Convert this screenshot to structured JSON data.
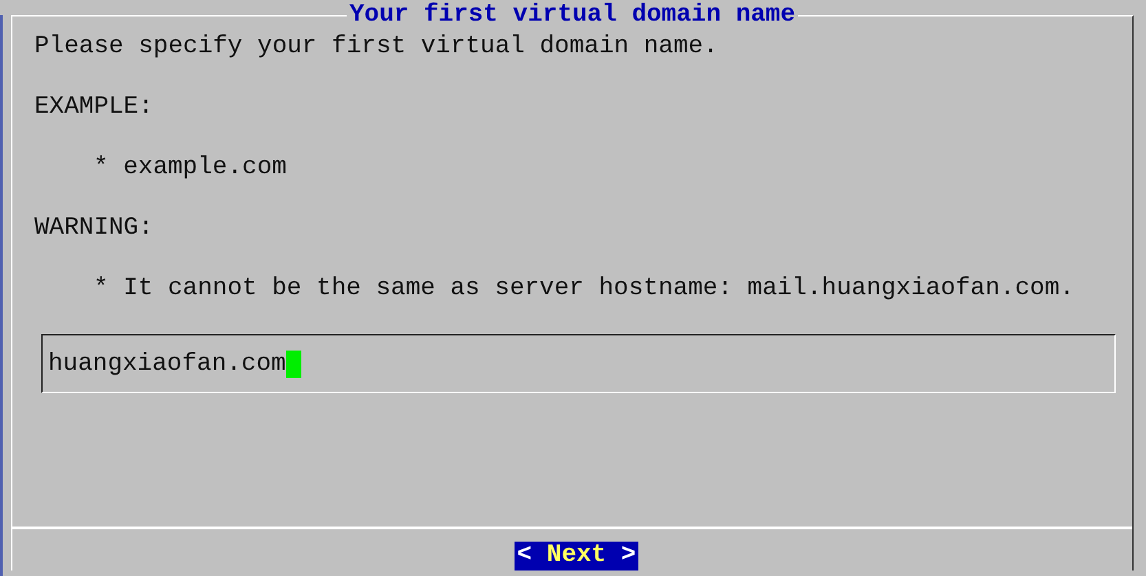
{
  "dialog": {
    "title": "Your first virtual domain name",
    "lines": [
      {
        "kind": "text",
        "text": "Please specify your first virtual domain name."
      },
      {
        "kind": "text",
        "text": "EXAMPLE:"
      },
      {
        "kind": "bullet",
        "text": "* example.com"
      },
      {
        "kind": "text",
        "text": "WARNING:"
      },
      {
        "kind": "bullet",
        "text": "* It cannot be the same as server hostname: mail.huangxiaofan.com."
      }
    ],
    "input": {
      "value": "huangxiaofan.com",
      "focused": true
    },
    "buttons": [
      {
        "left": "<",
        "label": "Next",
        "right": ">",
        "selected": true
      }
    ]
  }
}
